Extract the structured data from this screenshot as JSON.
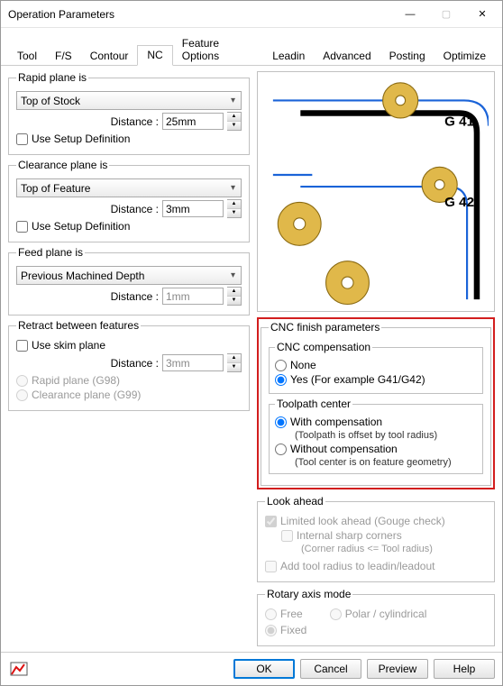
{
  "window": {
    "title": "Operation Parameters"
  },
  "tabs": [
    "Tool",
    "F/S",
    "Contour",
    "NC",
    "Feature Options",
    "Leadin",
    "Advanced",
    "Posting",
    "Optimize"
  ],
  "activeTab": "NC",
  "rapidPlane": {
    "legend": "Rapid plane is",
    "value": "Top of Stock",
    "distanceLabel": "Distance :",
    "distance": "25mm",
    "useSetup": "Use Setup Definition"
  },
  "clearancePlane": {
    "legend": "Clearance plane is",
    "value": "Top of Feature",
    "distanceLabel": "Distance :",
    "distance": "3mm",
    "useSetup": "Use Setup Definition"
  },
  "feedPlane": {
    "legend": "Feed plane is",
    "value": "Previous Machined Depth",
    "distanceLabel": "Distance :",
    "distance": "1mm"
  },
  "retract": {
    "legend": "Retract between features",
    "useSkim": "Use skim plane",
    "distanceLabel": "Distance :",
    "distance": "3mm",
    "rapid": "Rapid plane (G98)",
    "clearance": "Clearance plane (G99)"
  },
  "cncFinish": {
    "legend": "CNC finish parameters",
    "compLegend": "CNC compensation",
    "comp_none": "None",
    "comp_yes": "Yes (For example G41/G42)",
    "tpCenterLegend": "Toolpath center",
    "tp_with": "With compensation",
    "tp_with_desc": "(Toolpath is offset by tool radius)",
    "tp_without": "Without compensation",
    "tp_without_desc": "(Tool center is on feature geometry)"
  },
  "lookAhead": {
    "legend": "Look ahead",
    "limited": "Limited look ahead (Gouge check)",
    "internalSharp": "Internal sharp corners",
    "internalDesc": "(Corner radius <= Tool radius)",
    "addRadius": "Add tool radius to leadin/leadout"
  },
  "rotary": {
    "legend": "Rotary axis mode",
    "free": "Free",
    "polar": "Polar / cylindrical",
    "fixed": "Fixed"
  },
  "preview": {
    "g41": "G 41",
    "g42": "G 42"
  },
  "buttons": {
    "ok": "OK",
    "cancel": "Cancel",
    "preview": "Preview",
    "help": "Help"
  }
}
